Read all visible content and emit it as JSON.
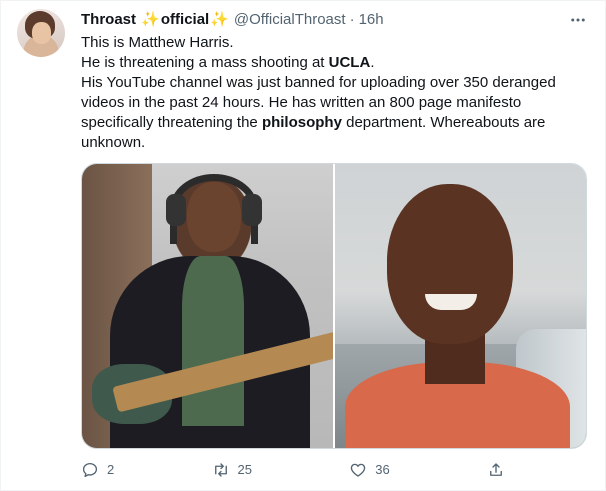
{
  "tweet": {
    "display_name": "Throast",
    "name_suffix": "official",
    "sparkle": "✨",
    "handle": "@OfficialThroast",
    "separator": "·",
    "time": "16h",
    "more_icon": "more-horizontal-icon",
    "lines": {
      "line1": "This is Matthew Harris.",
      "line2_pre": "He is threatening a mass shooting at ",
      "line2_bold": "UCLA",
      "line2_post": ".",
      "line3_pre": "His YouTube channel was just banned for uploading over 350 deranged videos in the past 24 hours. He has written an 800 page manifesto specifically threatening the ",
      "line3_bold": "philosophy",
      "line3_post": " department. Whereabouts are unknown."
    },
    "media_count": 2,
    "actions": {
      "reply": {
        "icon": "reply-icon",
        "count": "2"
      },
      "retweet": {
        "icon": "retweet-icon",
        "count": "25"
      },
      "like": {
        "icon": "heart-icon",
        "count": "36"
      },
      "share": {
        "icon": "share-icon",
        "count": ""
      }
    }
  },
  "colors": {
    "text": "#0f1419",
    "secondary": "#536471",
    "border": "#cfd9de",
    "sparkle": "#f2b71f"
  }
}
